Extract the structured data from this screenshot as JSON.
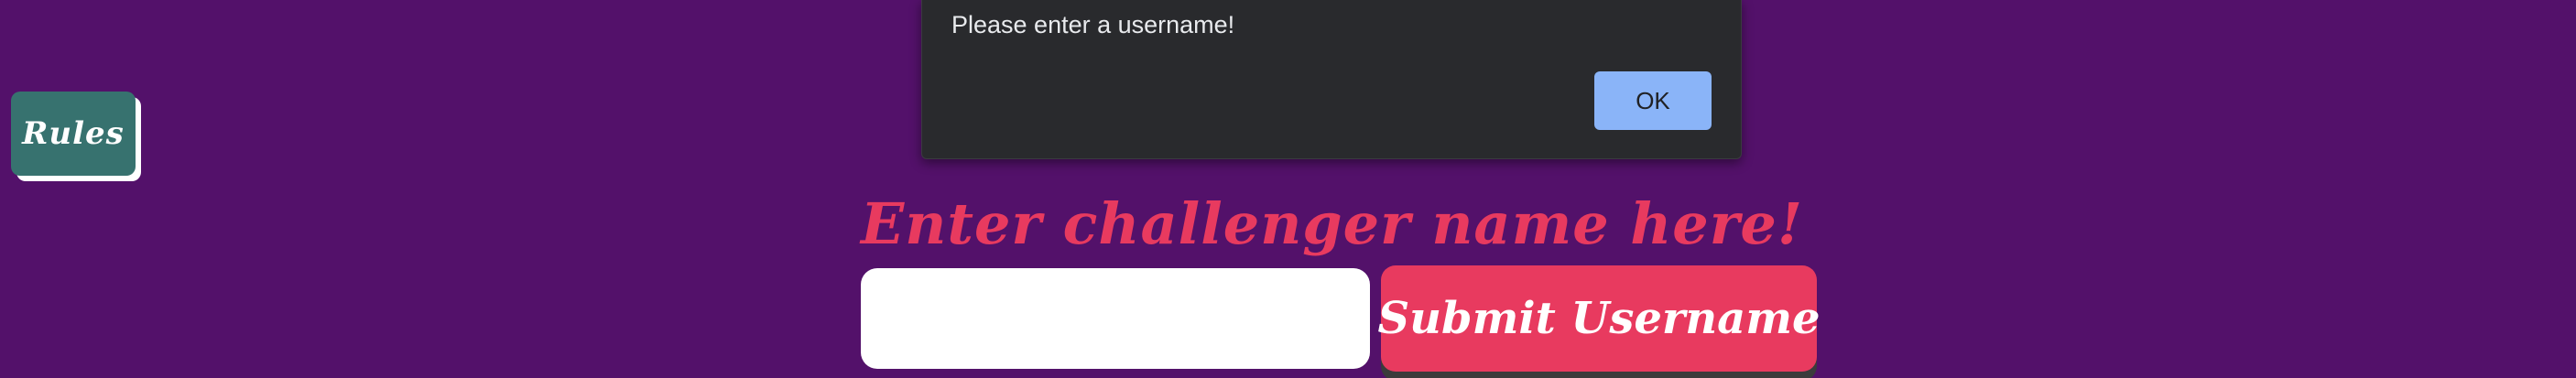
{
  "rules": {
    "label": "Rules"
  },
  "alert": {
    "message": "Please enter a username!",
    "ok_label": "OK"
  },
  "form": {
    "heading": "Enter challenger name here!",
    "username_value": "",
    "submit_label": "Submit Username"
  },
  "colors": {
    "background": "#53116a",
    "accent": "#e83a5f",
    "rules_button": "#37726f",
    "dialog": "#292a2d",
    "dialog_button": "#8ab4f8"
  }
}
